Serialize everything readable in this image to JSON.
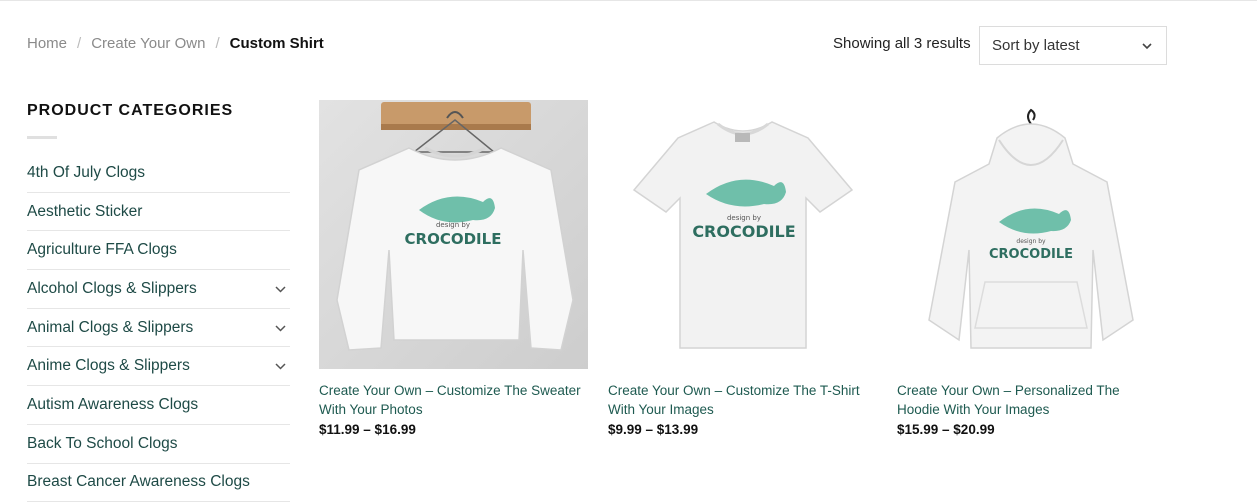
{
  "breadcrumb": {
    "home": "Home",
    "parent": "Create Your Own",
    "current": "Custom Shirt",
    "separator": "/"
  },
  "toolbar": {
    "results_text": "Showing all 3 results",
    "sort_selected": "Sort by latest"
  },
  "sidebar": {
    "title": "PRODUCT CATEGORIES",
    "items": [
      {
        "label": "4th Of July Clogs",
        "expandable": false
      },
      {
        "label": "Aesthetic Sticker",
        "expandable": false
      },
      {
        "label": "Agriculture FFA Clogs",
        "expandable": false
      },
      {
        "label": "Alcohol Clogs & Slippers",
        "expandable": true
      },
      {
        "label": "Animal Clogs & Slippers",
        "expandable": true
      },
      {
        "label": "Anime Clogs & Slippers",
        "expandable": true
      },
      {
        "label": "Autism Awareness Clogs",
        "expandable": false
      },
      {
        "label": "Back To School Clogs",
        "expandable": false
      },
      {
        "label": "Breast Cancer Awareness Clogs",
        "expandable": false
      }
    ]
  },
  "products": [
    {
      "name": "Create Your Own – Customize The Sweater With Your Photos",
      "price": "$11.99 – $16.99",
      "image": "sweater",
      "logo_small": "design by",
      "logo_big": "CROCODILE"
    },
    {
      "name": "Create Your Own – Customize The T-Shirt With Your Images",
      "price": "$9.99 – $13.99",
      "image": "tshirt",
      "logo_small": "design by",
      "logo_big": "CROCODILE"
    },
    {
      "name": "Create Your Own – Personalized The Hoodie With Your Images",
      "price": "$15.99 – $20.99",
      "image": "hoodie",
      "logo_small": "design by",
      "logo_big": "CROCODILE"
    }
  ],
  "colors": {
    "link": "#1e4a46",
    "product_link": "#1e5a50",
    "logo_green": "#6fbfaa",
    "logo_dark": "#2e6e60"
  }
}
